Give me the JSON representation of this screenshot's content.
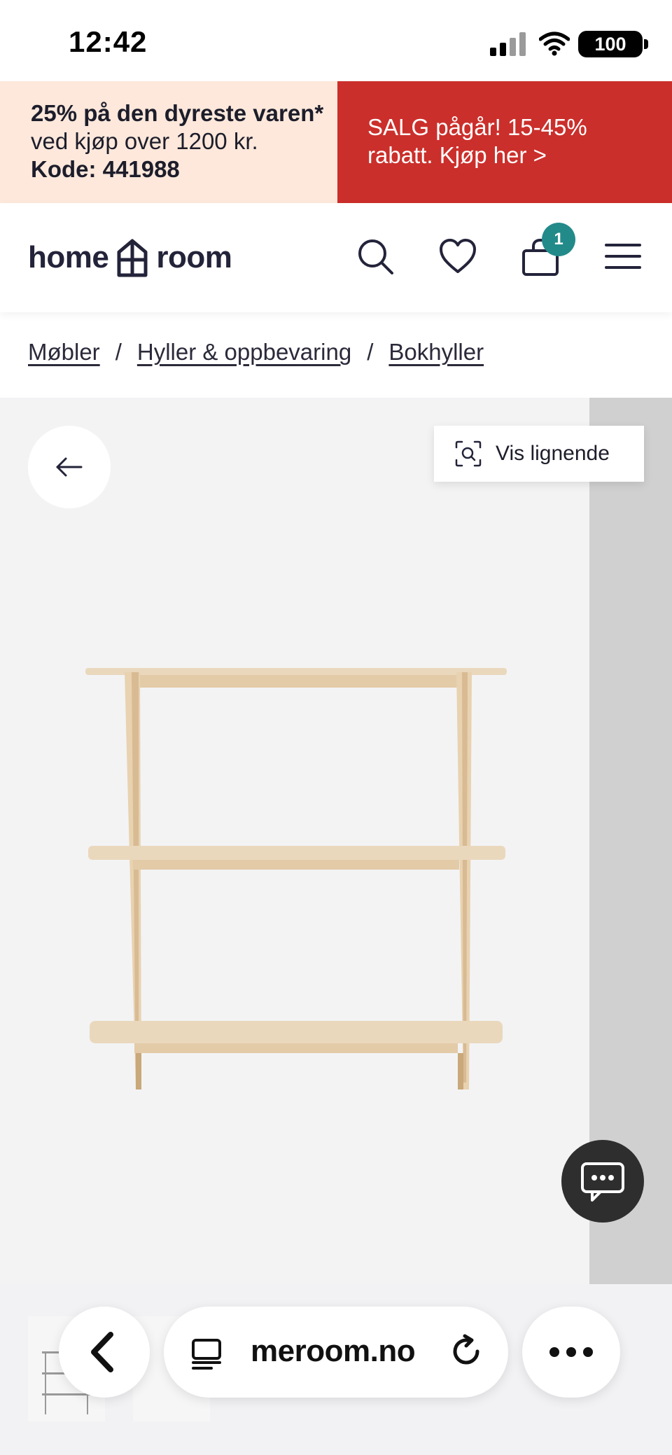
{
  "status_bar": {
    "time": "12:42",
    "battery": "100"
  },
  "promo": {
    "left": {
      "bold_1": "25% på den dyreste varen*",
      "text_1": " ved kjøp over 1200 kr. ",
      "bold_2": "Kode: 441988",
      "background": "#fde8db"
    },
    "right": {
      "text": "SALG pågår! 15-45% rabatt. Kjøp her >",
      "background": "#cb2f2b"
    }
  },
  "header": {
    "logo_left": "home",
    "logo_right": "room",
    "cart_count": "1",
    "icons": [
      "search-icon",
      "heart-icon",
      "cart-icon",
      "menu-icon"
    ],
    "accent": "#238a8a"
  },
  "breadcrumb": {
    "items": [
      "Møbler",
      "Hyller & oppbevaring",
      "Bokhyller"
    ],
    "separator": "/"
  },
  "product": {
    "similar_button": "Vis lignende",
    "image_icon": "bookshelf-image"
  },
  "browser": {
    "url": "meroom.no",
    "icons": [
      "chevron-left-icon",
      "reader-icon",
      "reload-icon",
      "more-icon"
    ]
  }
}
